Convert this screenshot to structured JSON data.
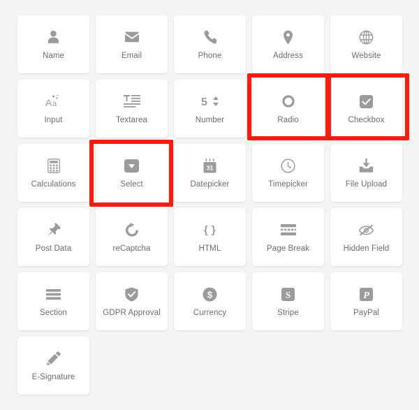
{
  "palette": {
    "page_background": "#f4f4f4",
    "tile_background": "#ffffff",
    "icon_gray": "#9b9b9b",
    "label_gray": "#6d6d6d",
    "highlight_red": "#fb1b0f"
  },
  "field_palette": {
    "rows": [
      [
        {
          "label": "Name",
          "icon": "user-icon"
        },
        {
          "label": "Email",
          "icon": "envelope-icon"
        },
        {
          "label": "Phone",
          "icon": "phone-icon"
        },
        {
          "label": "Address",
          "icon": "map-pin-icon"
        },
        {
          "label": "Website",
          "icon": "globe-icon"
        }
      ],
      [
        {
          "label": "Input",
          "icon": "text-aa-icon"
        },
        {
          "label": "Textarea",
          "icon": "text-lines-icon"
        },
        {
          "label": "Number",
          "icon": "number-stepper-icon",
          "glyph": "5"
        },
        {
          "label": "Radio",
          "icon": "radio-circle-icon"
        },
        {
          "label": "Checkbox",
          "icon": "checkbox-checked-icon"
        }
      ],
      [
        {
          "label": "Calculations",
          "icon": "calculator-icon"
        },
        {
          "label": "Select",
          "icon": "dropdown-caret-icon"
        },
        {
          "label": "Datepicker",
          "icon": "calendar-icon",
          "glyph": "31"
        },
        {
          "label": "Timepicker",
          "icon": "clock-icon"
        },
        {
          "label": "File Upload",
          "icon": "upload-tray-icon"
        }
      ],
      [
        {
          "label": "Post Data",
          "icon": "pushpin-icon"
        },
        {
          "label": "reCaptcha",
          "icon": "refresh-icon"
        },
        {
          "label": "HTML",
          "icon": "curly-braces-icon",
          "glyph": "{ }"
        },
        {
          "label": "Page Break",
          "icon": "page-break-icon"
        },
        {
          "label": "Hidden Field",
          "icon": "eye-slash-icon"
        }
      ],
      [
        {
          "label": "Section",
          "icon": "section-bars-icon"
        },
        {
          "label": "GDPR Approval",
          "icon": "shield-check-icon"
        },
        {
          "label": "Currency",
          "icon": "dollar-coin-icon"
        },
        {
          "label": "Stripe",
          "icon": "stripe-icon",
          "glyph": "S"
        },
        {
          "label": "PayPal",
          "icon": "paypal-icon",
          "glyph": "P"
        }
      ],
      [
        {
          "label": "E-Signature",
          "icon": "pencil-icon"
        }
      ]
    ]
  },
  "annotations": [
    {
      "name": "radio",
      "target": "Radio"
    },
    {
      "name": "checkbox",
      "target": "Checkbox"
    },
    {
      "name": "select",
      "target": "Select"
    }
  ]
}
